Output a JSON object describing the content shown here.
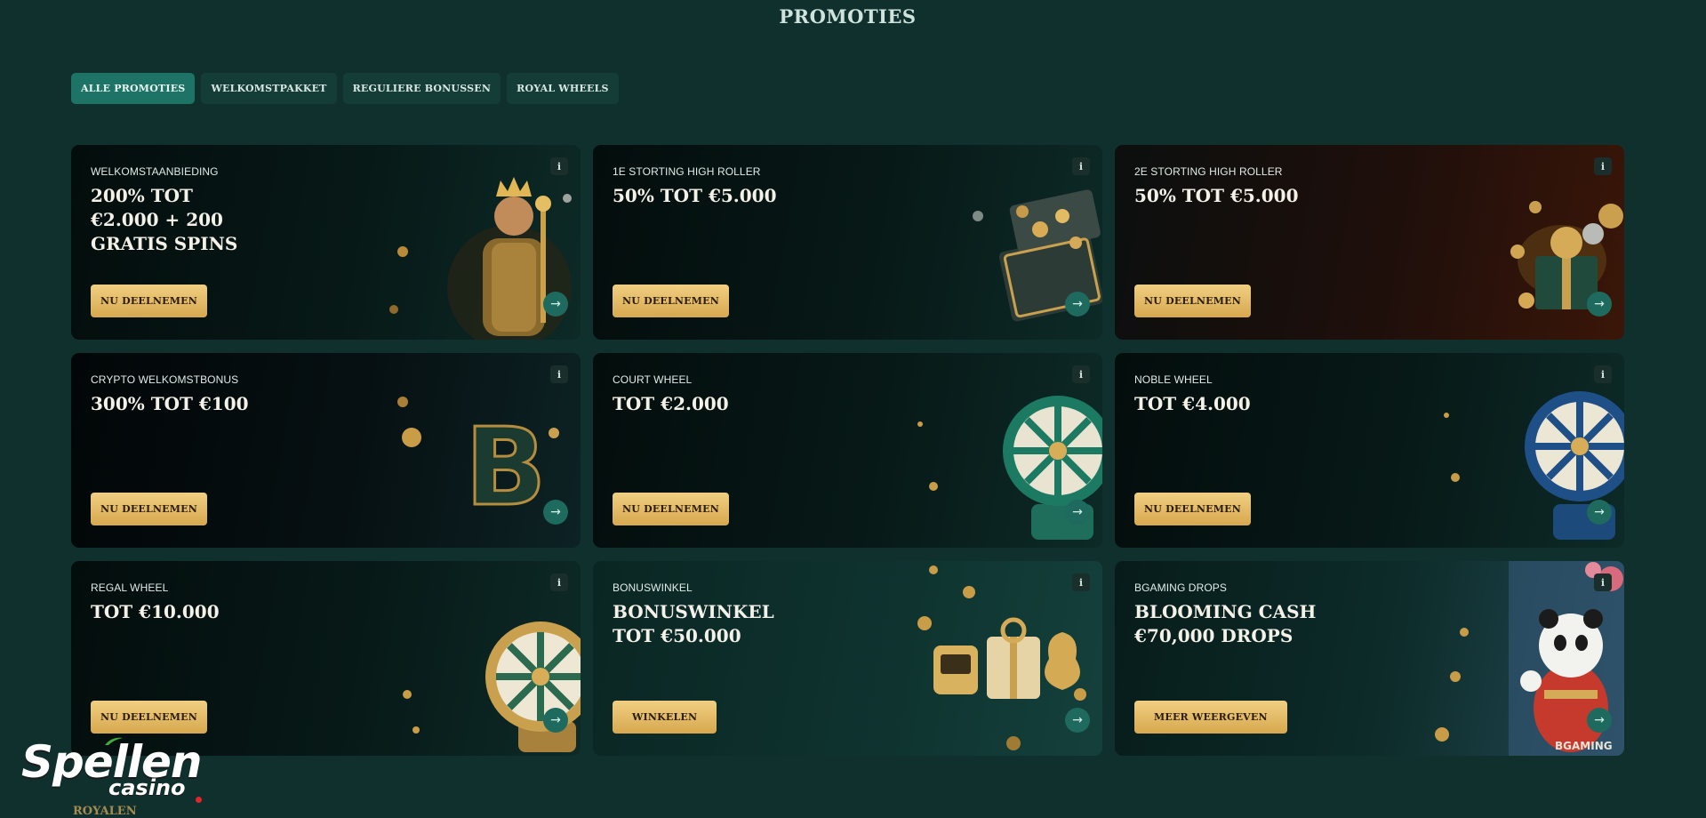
{
  "page": {
    "title": "PROMOTIES"
  },
  "tabs": [
    {
      "label": "ALLE PROMOTIES",
      "active": true
    },
    {
      "label": "WELKOMSTPAKKET",
      "active": false
    },
    {
      "label": "REGULIERE BONUSSEN",
      "active": false
    },
    {
      "label": "ROYAL WHEELS",
      "active": false
    }
  ],
  "cards": [
    {
      "eyebrow": "WELKOMSTAANBIEDING",
      "headline": [
        "200% TOT",
        "€2.000 + 200",
        "GRATIS SPINS"
      ],
      "button": "NU DEELNEMEN",
      "info": "i",
      "arrow": "→",
      "art": "king-icon"
    },
    {
      "eyebrow": "1E STORTING HIGH ROLLER",
      "headline": [
        "50% TOT €5.000"
      ],
      "button": "NU DEELNEMEN",
      "info": "i",
      "arrow": "→",
      "art": "treasure-chest-icon"
    },
    {
      "eyebrow": "2E STORTING HIGH ROLLER",
      "headline": [
        "50% TOT €5.000"
      ],
      "button": "NU DEELNEMEN",
      "info": "i",
      "arrow": "→",
      "art": "gift-coins-icon"
    },
    {
      "eyebrow": "CRYPTO WELKOMSTBONUS",
      "headline": [
        "300% TOT €100"
      ],
      "button": "NU DEELNEMEN",
      "info": "i",
      "arrow": "→",
      "art": "bitcoin-icon"
    },
    {
      "eyebrow": "COURT WHEEL",
      "headline": [
        "TOT €2.000"
      ],
      "button": "NU DEELNEMEN",
      "info": "i",
      "arrow": "→",
      "art": "green-wheel-icon"
    },
    {
      "eyebrow": "NOBLE WHEEL",
      "headline": [
        "TOT €4.000"
      ],
      "button": "NU DEELNEMEN",
      "info": "i",
      "arrow": "→",
      "art": "blue-wheel-icon"
    },
    {
      "eyebrow": "REGAL WHEEL",
      "headline": [
        "TOT €10.000"
      ],
      "button": "NU DEELNEMEN",
      "info": "i",
      "arrow": "→",
      "art": "gold-wheel-icon"
    },
    {
      "eyebrow": "BONUSWINKEL",
      "headline": [
        "BONUSWINKEL",
        "TOT €50.000"
      ],
      "button": "WINKELEN",
      "info": "i",
      "arrow": "→",
      "art": "slot-gift-moneybag-icon"
    },
    {
      "eyebrow": "BGAMING DROPS",
      "headline": [
        "BLOOMING CASH",
        "€70,000 DROPS"
      ],
      "button": "MEER WEERGEVEN",
      "info": "i",
      "arrow": "→",
      "art": "panda-icon",
      "art_text": "BGAMING"
    }
  ],
  "logo": {
    "main": "Spellen",
    "sub": "casino"
  },
  "footer": {
    "brand": "ROYALEN"
  },
  "colors": {
    "background": "#10302e",
    "tab_active": "#1d7466",
    "button_gold": "#e8c06a",
    "accent_red": "#e0262b"
  }
}
